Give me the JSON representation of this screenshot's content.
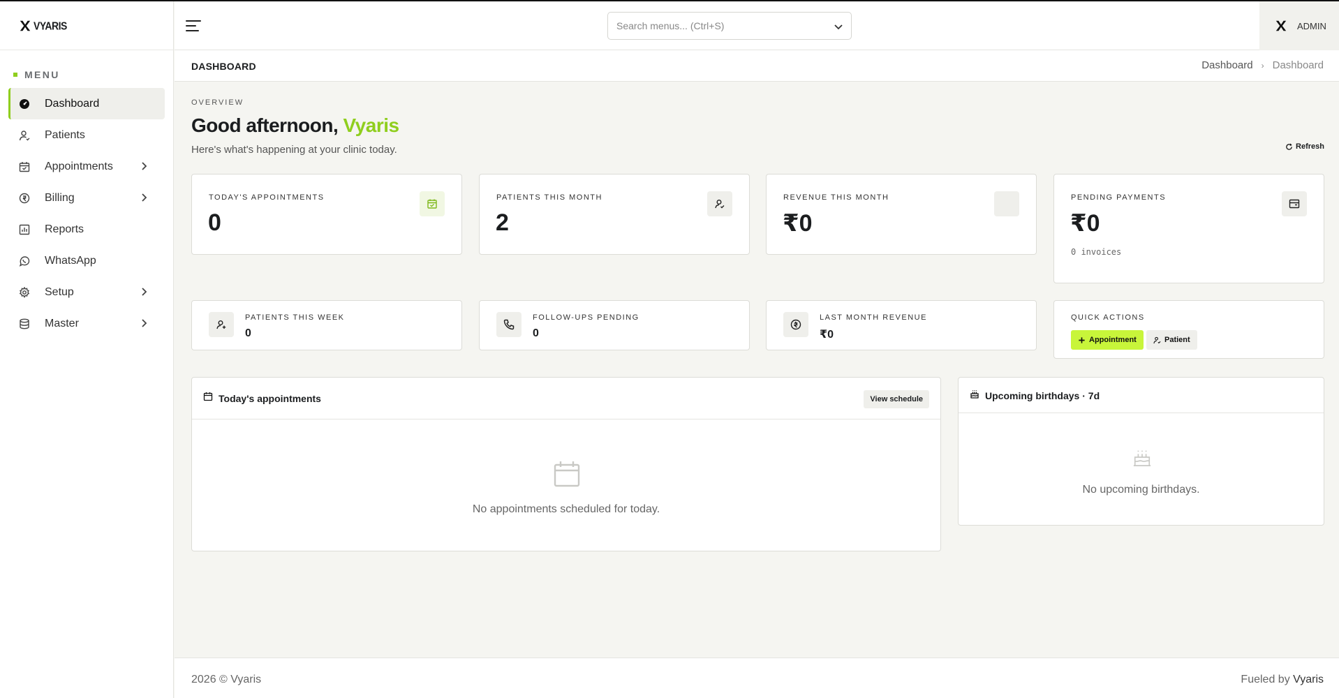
{
  "brand": {
    "name": "VYARIS"
  },
  "sidebar": {
    "menu_label": "MENU",
    "items": [
      {
        "label": "Dashboard",
        "icon": "dashboard-icon",
        "has_children": false,
        "active": true
      },
      {
        "label": "Patients",
        "icon": "user-icon",
        "has_children": false
      },
      {
        "label": "Appointments",
        "icon": "calendar-icon",
        "has_children": true
      },
      {
        "label": "Billing",
        "icon": "billing-icon",
        "has_children": true
      },
      {
        "label": "Reports",
        "icon": "reports-icon",
        "has_children": false
      },
      {
        "label": "WhatsApp",
        "icon": "whatsapp-icon",
        "has_children": false
      },
      {
        "label": "Setup",
        "icon": "gear-icon",
        "has_children": true
      },
      {
        "label": "Master",
        "icon": "database-icon",
        "has_children": true
      }
    ]
  },
  "header": {
    "search_placeholder": "Search menus... (Ctrl+S)",
    "user_label": "ADMIN"
  },
  "subheader": {
    "page_title": "DASHBOARD",
    "breadcrumbs": [
      "Dashboard",
      "Dashboard"
    ]
  },
  "overview": {
    "eyebrow": "OVERVIEW",
    "greeting_prefix": "Good afternoon,",
    "greeting_name": "Vyaris",
    "subtitle": "Here's what's happening at your clinic today.",
    "refresh_label": "Refresh"
  },
  "stats": [
    {
      "label": "TODAY'S APPOINTMENTS",
      "value": "0",
      "icon": "calendar-check-icon"
    },
    {
      "label": "PATIENTS THIS MONTH",
      "value": "2",
      "icon": "user-check-icon"
    },
    {
      "label": "REVENUE THIS MONTH",
      "value": "₹0",
      "icon": "blank-icon"
    },
    {
      "label": "PENDING PAYMENTS",
      "value": "₹0",
      "sub": "0 invoices",
      "icon": "wallet-icon"
    }
  ],
  "mini_stats": [
    {
      "label": "PATIENTS THIS WEEK",
      "value": "0",
      "icon": "user-plus-icon"
    },
    {
      "label": "FOLLOW-UPS PENDING",
      "value": "0",
      "icon": "phone-icon"
    },
    {
      "label": "LAST MONTH REVENUE",
      "value": "₹0",
      "icon": "currency-icon"
    }
  ],
  "quick_actions": {
    "label": "QUICK ACTIONS",
    "primary": "Appointment",
    "secondary": "Patient"
  },
  "appointments_panel": {
    "title": "Today's appointments",
    "button": "View schedule",
    "empty": "No appointments scheduled for today."
  },
  "birthdays_panel": {
    "title": "Upcoming birthdays · 7d",
    "empty": "No upcoming birthdays."
  },
  "footer": {
    "copyright": "2026 © Vyaris",
    "fueled_prefix": "Fueled by",
    "fueled_brand": "Vyaris"
  },
  "colors": {
    "accent": "#8fce1e",
    "accent_button": "#c8f53a",
    "background": "#f5f5f1"
  }
}
